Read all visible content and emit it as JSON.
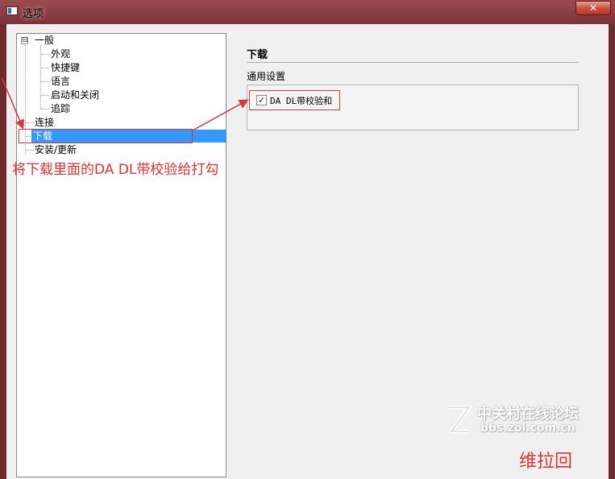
{
  "window": {
    "title": "选项",
    "close_label": "✕"
  },
  "tree": {
    "items": [
      {
        "label": "一般",
        "expander": "⊟"
      },
      {
        "label": "外观"
      },
      {
        "label": "快捷键"
      },
      {
        "label": "语言"
      },
      {
        "label": "启动和关闭"
      },
      {
        "label": "追踪"
      },
      {
        "label": "连接"
      },
      {
        "label": "下载",
        "selected": true
      },
      {
        "label": "安装/更新"
      }
    ]
  },
  "panel": {
    "section_title": "下载",
    "group_label": "通用设置",
    "checkbox_label": "DA DL带校验和",
    "checkbox_checked": true,
    "checkbox_mark": "✓"
  },
  "annotation": {
    "text": "将下载里面的DA DL带校验给打勾",
    "color": "#e03030"
  },
  "watermark": {
    "cn": "中关村在线论坛",
    "en": "bbs.zol.com.cn",
    "corner": "维拉回"
  },
  "colors": {
    "selection": "#3399ff",
    "highlight": "#d43a3a",
    "titlebar": "#8c3a3f"
  }
}
